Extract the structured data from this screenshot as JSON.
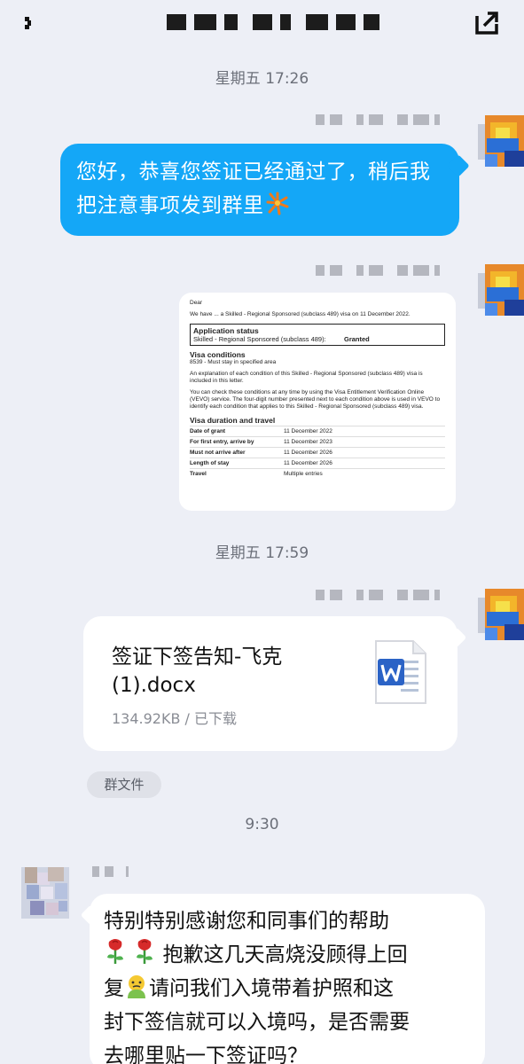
{
  "header": {
    "title": "",
    "icons": [
      "back-icon",
      "share-icon"
    ]
  },
  "messages": {
    "ts1": "星期五 17:26",
    "msg1_text": "您好，恭喜您签证已经通过了，稍后我把注意事项发到群里",
    "visa_letter": {
      "dear": "Dear",
      "intro": "We have ... a Skilled - Regional Sponsored (subclass 489) visa on 11 December 2022.",
      "status_heading": "Application status",
      "status_visa": "Skilled - Regional Sponsored (subclass 489):",
      "status_value": "Granted",
      "conditions_heading": "Visa conditions",
      "condition_1": "8539 - Must stay in specified area",
      "explanation": "An explanation of each condition of this Skilled - Regional Sponsored (subclass 489) visa is included in this letter.",
      "vevo": "You can check these conditions at any time by using the Visa Entitlement Verification Online (VEVO) service. The four-digit number presented next to each condition above is used in VEVO to identify each condition that applies to this Skilled - Regional Sponsored (subclass 489) visa.",
      "duration_heading": "Visa duration and travel",
      "rows": [
        {
          "k": "Date of grant",
          "v": "11 December 2022"
        },
        {
          "k": "For first entry, arrive by",
          "v": "11 December 2023"
        },
        {
          "k": "Must not arrive after",
          "v": "11 December 2026"
        },
        {
          "k": "Length of stay",
          "v": "11 December 2026"
        },
        {
          "k": "Travel",
          "v": "Multiple entries"
        }
      ]
    },
    "ts2": "星期五 17:59",
    "file_name": "签证下签告知-飞克(1).docx",
    "file_meta": "134.92KB / 已下载",
    "group_file_label": "群文件",
    "ts3": "9:30",
    "reply_line1": "特别特别感谢您和同事们的帮助",
    "reply_line2": "抱歉这几天高烧没顾得上回",
    "reply_line3a": "复",
    "reply_line3b": "请问我们入境带着护照和这",
    "reply_line4": "封下签信就可以入境吗，是否需要",
    "reply_line5": "去哪里贴一下签证吗？"
  }
}
